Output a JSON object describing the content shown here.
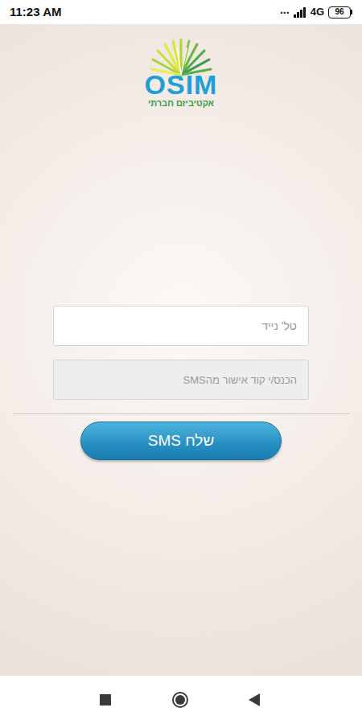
{
  "status_bar": {
    "time": "11:23 AM",
    "dots": "...",
    "network": "4G",
    "battery": "96"
  },
  "logo": {
    "name": "OSIM",
    "tagline": "אקטיביזם חברתי"
  },
  "form": {
    "phone": {
      "placeholder": "טל' נייד",
      "disabled": false
    },
    "code": {
      "placeholder": "הכנס/י קוד אישור מהSMS",
      "disabled": true
    },
    "button": "שלח SMS"
  }
}
